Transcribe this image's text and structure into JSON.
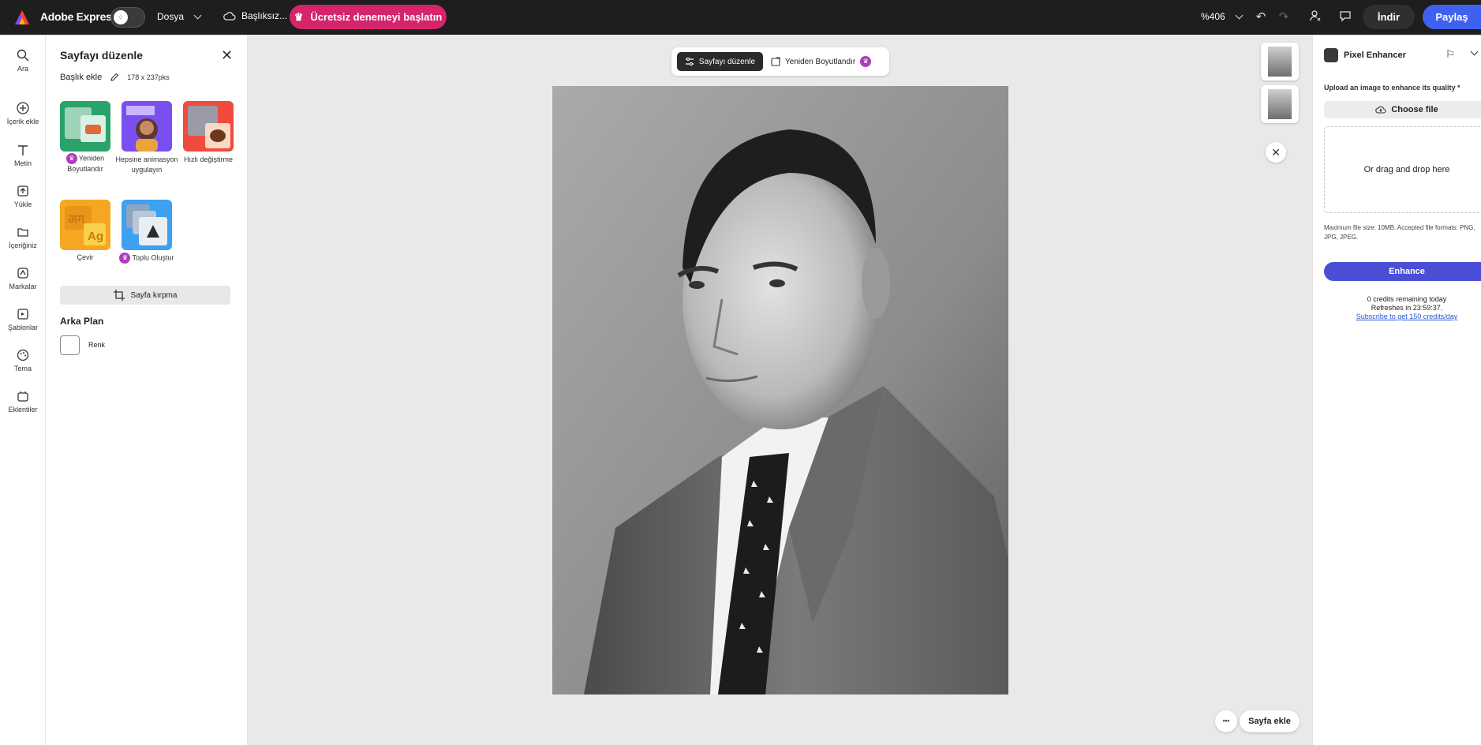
{
  "app": {
    "brand": "Adobe Express",
    "file_menu": "Dosya",
    "doc_title": "Başlıksız...",
    "trial_button": "Ücretsiz denemeyi başlatın",
    "zoom": "%406",
    "download": "İndir",
    "share": "Paylaş"
  },
  "left_rail": [
    {
      "label": "Ara",
      "icon": "search-icon"
    },
    {
      "label": "İçerik ekle",
      "icon": "plus-circle-icon"
    },
    {
      "label": "Metin",
      "icon": "text-icon"
    },
    {
      "label": "Yükle",
      "icon": "upload-icon"
    },
    {
      "label": "İçeriğiniz",
      "icon": "folder-icon"
    },
    {
      "label": "Markalar",
      "icon": "brand-icon"
    },
    {
      "label": "Şablonlar",
      "icon": "template-icon"
    },
    {
      "label": "Tema",
      "icon": "palette-icon"
    },
    {
      "label": "Eklentiler",
      "icon": "addons-icon"
    }
  ],
  "panel": {
    "title": "Sayfayı düzenle",
    "add_title": "Başlık ekle",
    "dimensions": "178 x 237pks",
    "tiles": [
      {
        "label": "Yeniden Boyutlandır",
        "premium": true
      },
      {
        "label": "Hepsine animasyon uygulayın",
        "premium": false
      },
      {
        "label": "Hızlı değiştirme",
        "premium": false
      },
      {
        "label": "Çevir",
        "premium": false
      },
      {
        "label": "Toplu Oluştur",
        "premium": true
      }
    ],
    "crop_button": "Sayfa kırpma",
    "background_title": "Arka Plan",
    "color_label": "Renk"
  },
  "canvas": {
    "edit_page_tab": "Sayfayı düzenle",
    "resize_tab": "Yeniden Boyutlandır",
    "add_page": "Sayfa ekle",
    "more": "•••"
  },
  "addon": {
    "name": "Pixel Enhancer",
    "upload_label": "Upload an image to enhance its quality",
    "required_mark": "*",
    "choose_file": "Choose file",
    "drop_text": "Or drag and drop here",
    "limits": "Maximum file size: 10MB. Accepted file formats: PNG, JPG, JPEG.",
    "enhance": "Enhance",
    "credits_line": "0 credits remaining today",
    "refresh_line": "Refreshes in  23:59:37.",
    "subscribe_link": "Subscribe to get 150 credits/day"
  }
}
